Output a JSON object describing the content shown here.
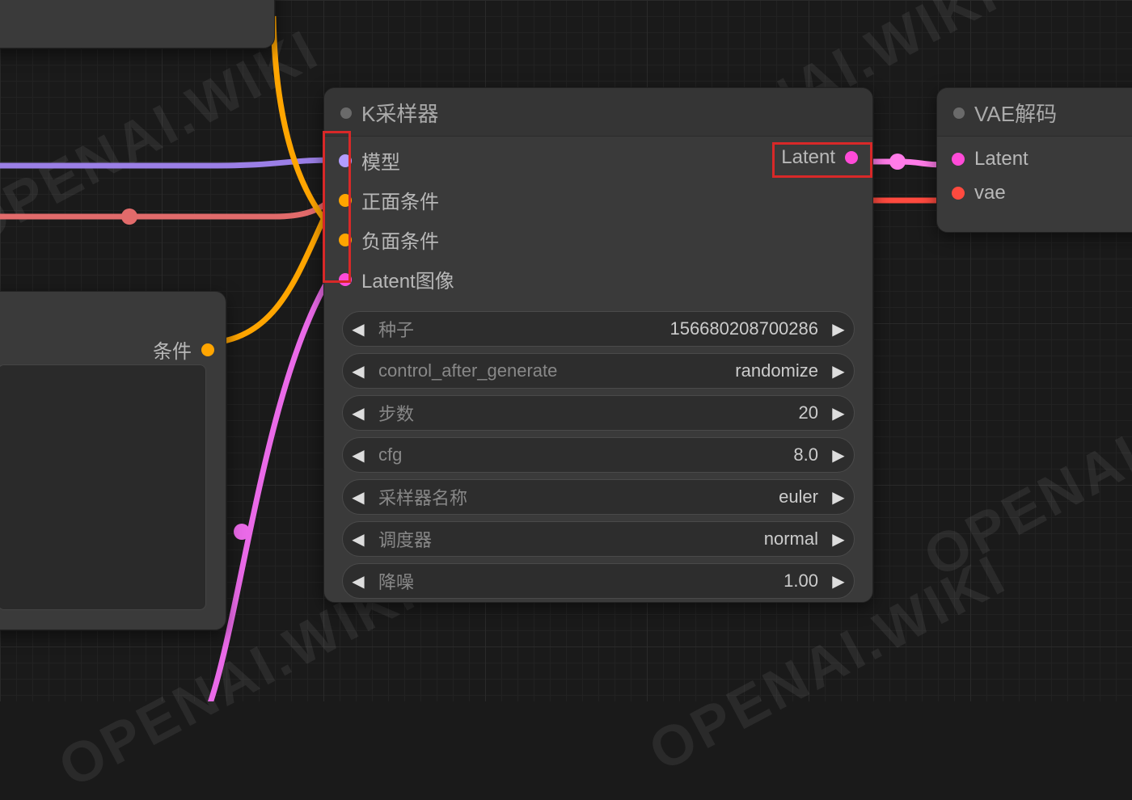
{
  "watermark_text": "OPENAI.WIKI",
  "ksampler": {
    "title": "K采样器",
    "inputs": {
      "model": "模型",
      "positive": "正面条件",
      "negative": "负面条件",
      "latent_image": "Latent图像"
    },
    "outputs": {
      "latent": "Latent"
    },
    "widgets": {
      "seed_label": "种子",
      "seed_value": "156680208700286",
      "control_after_generate_label": "control_after_generate",
      "control_after_generate_value": "randomize",
      "steps_label": "步数",
      "steps_value": "20",
      "cfg_label": "cfg",
      "cfg_value": "8.0",
      "sampler_label": "采样器名称",
      "sampler_value": "euler",
      "scheduler_label": "调度器",
      "scheduler_value": "normal",
      "denoise_label": "降噪",
      "denoise_value": "1.00"
    }
  },
  "vae_decode": {
    "title": "VAE解码",
    "inputs": {
      "latent": "Latent",
      "vae": "vae"
    }
  },
  "left_prompt_node": {
    "output_label": "条件"
  },
  "colors": {
    "model_port": "#b29dff",
    "conditioning_port": "#ffa500",
    "latent_port": "#ff4bd8",
    "vae_port": "#ff4a3f",
    "wire_purple": "#9b7fe6",
    "wire_red": "#e26b6b",
    "wire_orange": "#ffa500",
    "wire_pink_light": "#ff7be8",
    "wire_pink": "#ea6ae8"
  }
}
